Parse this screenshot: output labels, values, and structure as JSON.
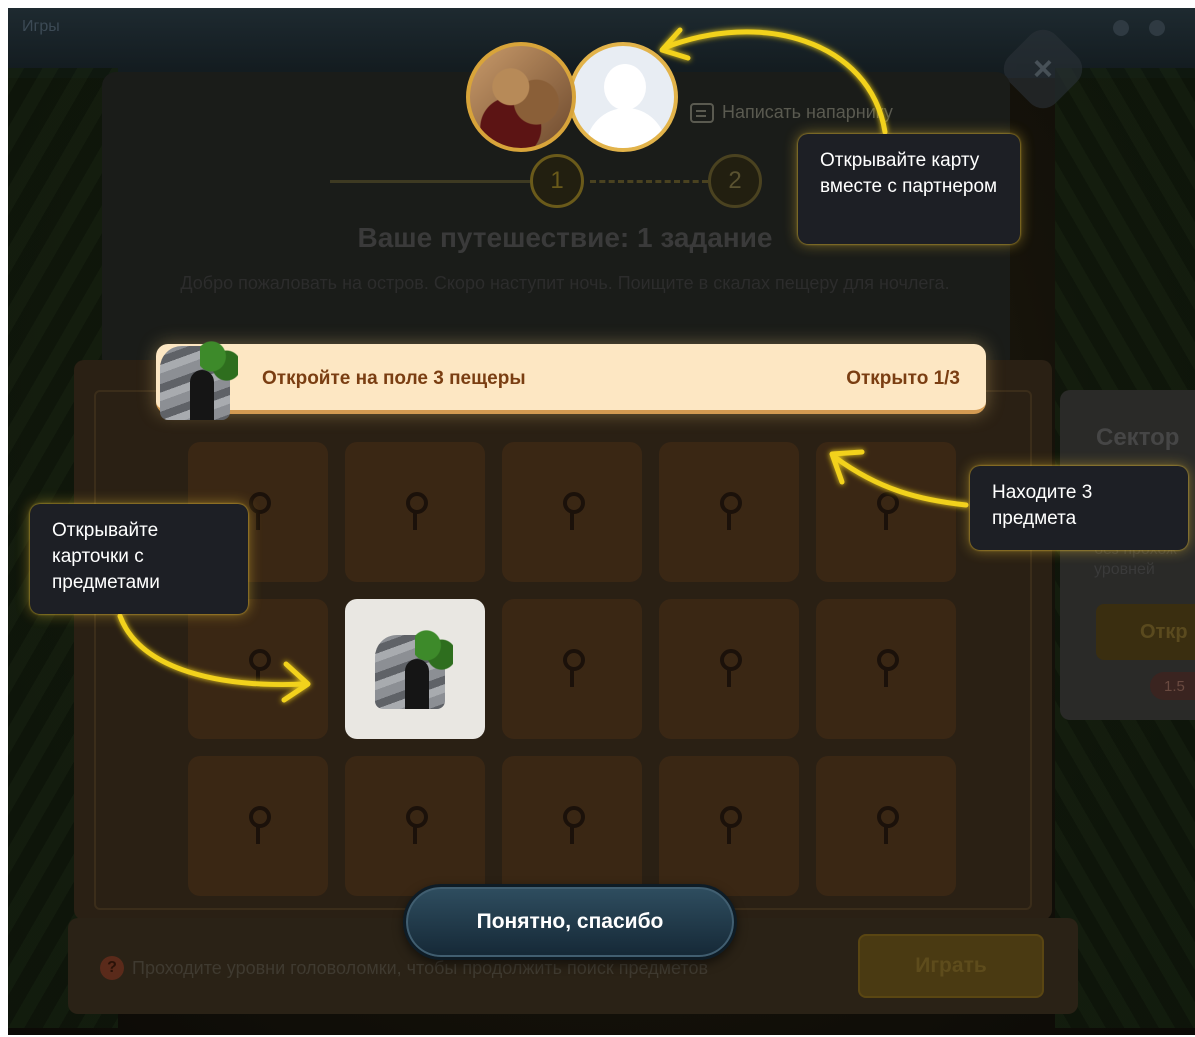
{
  "header": {
    "app_title": "Игры"
  },
  "modal": {
    "chat_link": "Написать напарнику",
    "steps": [
      "1",
      "2"
    ],
    "title": "Ваше путешествие: 1 задание",
    "description": "Добро пожаловать на остров. Скоро наступит ночь. Поищите в скалах пещеру для ночлега."
  },
  "task": {
    "text": "Откройте на поле 3 пещеры",
    "progress": "Открыто 1/3",
    "opened": 1,
    "total": 3
  },
  "board": {
    "rows": 3,
    "cols": 5,
    "opened_cells": [
      {
        "row": 2,
        "col": 2,
        "item": "cave"
      }
    ]
  },
  "side_panel": {
    "title": "Сектор",
    "text": "без прохож уровней",
    "button": "Откр",
    "pill": "1.5"
  },
  "bottom": {
    "help_badge": "?",
    "info": "Проходите уровни головоломки, чтобы продолжить поиск предметов",
    "play_button": "Играть"
  },
  "overlay": {
    "confirm_button": "Понятно, спасибо",
    "tips": {
      "partner": "Открывайте карту вместе с партнером",
      "items": "Находите 3 предмета",
      "cards": "Открывайте карточки с предметами"
    }
  },
  "colors": {
    "accent": "#f2d21c",
    "banner_bg": "#fde7c3",
    "banner_text": "#7a3e12",
    "tooltip_bg": "#1d1f25",
    "button_bg": "#1f3a4a"
  },
  "icons": {
    "close": "close-icon",
    "chat": "chat-icon",
    "key": "keyhole-icon",
    "help": "question-icon",
    "cave": "cave-icon"
  }
}
